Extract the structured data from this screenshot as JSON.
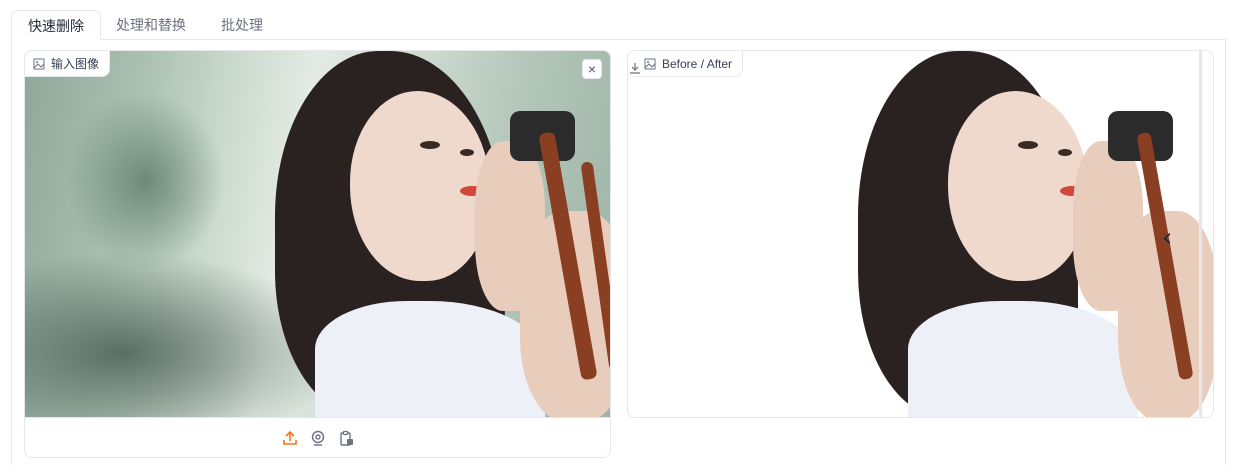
{
  "tabs": [
    {
      "label": "快速删除",
      "active": true
    },
    {
      "label": "处理和替换",
      "active": false
    },
    {
      "label": "批处理",
      "active": false
    }
  ],
  "input_panel": {
    "label": "输入图像",
    "close_icon": "×",
    "tools": [
      {
        "name": "upload-icon",
        "color": "#f97316"
      },
      {
        "name": "webcam-icon",
        "color": "#6b7280"
      },
      {
        "name": "clipboard-icon",
        "color": "#6b7280"
      }
    ]
  },
  "output_panel": {
    "label": "Before / After",
    "slider_arrow": "‹"
  },
  "colors": {
    "accent": "#f97316",
    "border": "#e5e7eb"
  }
}
